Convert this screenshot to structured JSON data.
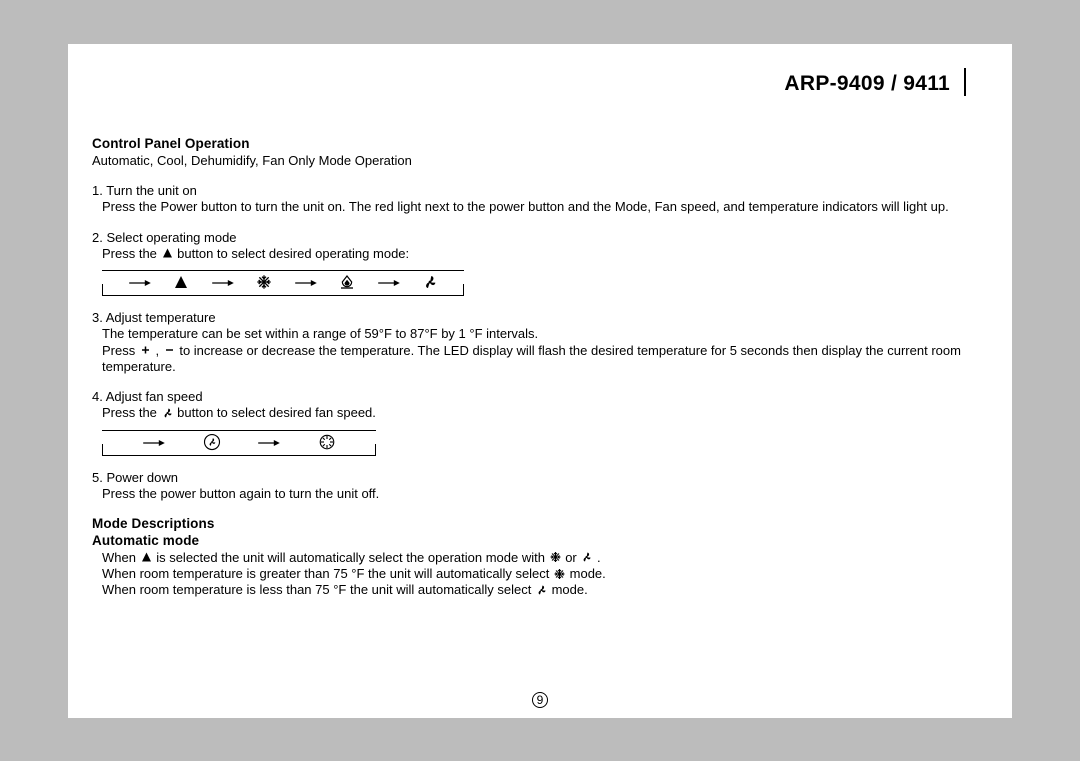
{
  "header": {
    "model": "ARP-9409 / 9411"
  },
  "sections": {
    "control_panel": {
      "title": "Control Panel Operation",
      "subtitle": "Automatic, Cool, Dehumidify, Fan Only Mode Operation",
      "steps": {
        "s1": {
          "label": "1. Turn the unit on",
          "body": "Press the Power button to turn the unit on.  The red light next to the power button and the Mode, Fan speed, and temperature indicators will light up."
        },
        "s2": {
          "label": "2. Select operating mode",
          "body_a": "Press the ",
          "body_b": " button to select desired operating mode:"
        },
        "s3": {
          "label": "3. Adjust temperature",
          "body1": "The temperature can be set within a range of 59°F to 87°F by 1 °F intervals.",
          "body2_a": "Press ",
          "body2_b": " , ",
          "body2_c": " to increase or decrease the temperature.  The LED display will flash the desired temperature for 5 seconds then display the current room temperature."
        },
        "s4": {
          "label": "4. Adjust fan speed",
          "body_a": "Press the ",
          "body_b": " button to select desired fan speed."
        },
        "s5": {
          "label": "5. Power down",
          "body": "Press the power button again to turn the unit off."
        }
      }
    },
    "mode_desc": {
      "title": "Mode Descriptions",
      "subtitle": "Automatic mode",
      "lines": {
        "l1_a": "When ",
        "l1_b": " is selected the unit will automatically select the operation mode with ",
        "l1_c": " or ",
        "l1_d": " .",
        "l2_a": "When room temperature is greater than 75 °F the unit will automatically select ",
        "l2_b": " mode.",
        "l3_a": "When room temperature is less than 75 °F the unit will automatically select ",
        "l3_b": " mode."
      }
    }
  },
  "page_number": "9"
}
